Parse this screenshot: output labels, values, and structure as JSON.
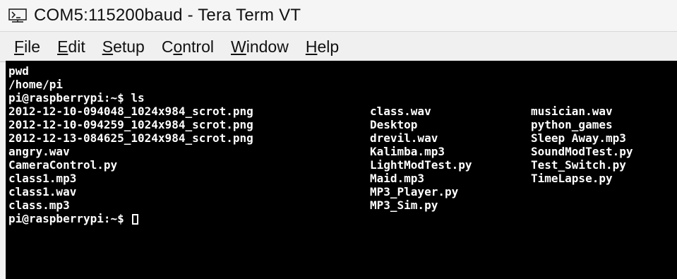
{
  "window": {
    "title": "COM5:115200baud - Tera Term VT",
    "app_icon": "tera-term-icon"
  },
  "menu": {
    "items": [
      {
        "mnemonic": "F",
        "rest": "ile"
      },
      {
        "mnemonic": "E",
        "rest": "dit"
      },
      {
        "mnemonic": "S",
        "rest": "etup"
      },
      {
        "pre": "C",
        "mnemonic": "o",
        "rest": "ntrol"
      },
      {
        "mnemonic": "W",
        "rest": "indow"
      },
      {
        "mnemonic": "H",
        "rest": "elp"
      }
    ]
  },
  "terminal": {
    "lines": [
      "pwd",
      "/home/pi",
      "pi@raspberrypi:~$ ls"
    ],
    "ls_rows": [
      [
        "2012-12-10-094048_1024x984_scrot.png",
        "class.wav",
        "musician.wav"
      ],
      [
        "2012-12-10-094259_1024x984_scrot.png",
        "Desktop",
        "python_games"
      ],
      [
        "2012-12-13-084625_1024x984_scrot.png",
        "drevil.wav",
        "Sleep Away.mp3"
      ],
      [
        "angry.wav",
        "Kalimba.mp3",
        "SoundModTest.py"
      ],
      [
        "CameraControl.py",
        "LightModTest.py",
        "Test_Switch.py"
      ],
      [
        "class1.mp3",
        "Maid.mp3",
        "TimeLapse.py"
      ],
      [
        "class1.wav",
        "MP3_Player.py",
        ""
      ],
      [
        "class.mp3",
        "MP3_Sim.py",
        ""
      ]
    ],
    "prompt": "pi@raspberrypi:~$ "
  }
}
